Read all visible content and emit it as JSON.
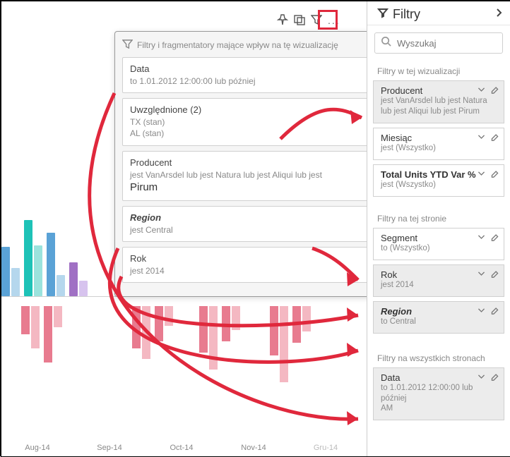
{
  "axis": {
    "aug": "Aug-14",
    "sep": "Sep-14",
    "oct": "Oct-14",
    "nov": "Nov-14",
    "gru": "Gru-14"
  },
  "toolbar": {
    "more": "..."
  },
  "tooltip": {
    "header": "Filtry i fragmentatory mające wpływ na tę wizualizację",
    "items": {
      "data": {
        "title": "Data",
        "sub": "to 1.01.2012 12:00:00 lub później"
      },
      "uwzg": {
        "title": "Uwzględnione (2)",
        "sub1": "TX (stan)",
        "sub2": "AL (stan)"
      },
      "prod": {
        "title": "Producent",
        "sub_pre": "jest VanArsdel lub jest Natura lub jest Aliqui lub jest",
        "sub_big": "Pirum"
      },
      "region": {
        "title": "Region",
        "sub": "jest Central"
      },
      "rok": {
        "title": "Rok",
        "sub": "jest 2014"
      }
    }
  },
  "pane": {
    "header": {
      "title": "Filtry",
      "collapse_sym": "V"
    },
    "search_placeholder": "Wyszukaj",
    "section_visual": "Filtry w tej wizualizacji",
    "cards_visual": {
      "producent": {
        "title": "Producent",
        "sub": "jest VanArsdel lub jest Natura lub jest Aliqui lub jest Pirum"
      },
      "miesiac": {
        "title": "Miesiąc",
        "sub": "jest (Wszystko)"
      },
      "total": {
        "title": "Total Units YTD Var %",
        "sub": "jest (Wszystko)"
      }
    },
    "section_page": "Filtry na tej stronie",
    "cards_page": {
      "segment": {
        "title": "Segment",
        "sub": "to (Wszystko)"
      },
      "rok": {
        "title": "Rok",
        "sub": "jest 2014"
      },
      "region": {
        "title": "Region",
        "sub": "to Central"
      }
    },
    "section_all": "Filtry na wszystkich stronach",
    "cards_all": {
      "data": {
        "title": "Data",
        "sub1": "to 1.01.2012 12:00:00 lub później",
        "sub2": "AM"
      }
    }
  },
  "chart_data": {
    "type": "bar",
    "note": "waterfall-style column chart partially obscured by tooltip; x-axis months Aug-14..Gru-14",
    "categories": [
      "Aug-14",
      "Sep-14",
      "Oct-14",
      "Nov-14",
      "Gru-14"
    ],
    "visible_direction": [
      "mixed",
      "negative",
      "negative",
      "negative",
      "negative"
    ],
    "title": "",
    "xlabel": "",
    "ylabel": ""
  }
}
